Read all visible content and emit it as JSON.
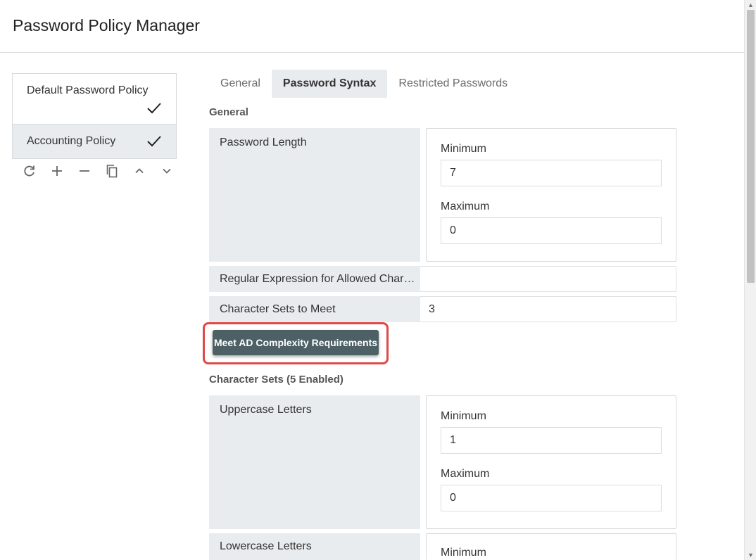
{
  "app": {
    "title": "Password Policy Manager"
  },
  "policies": [
    {
      "name": "Default Password Policy",
      "icon": "checkmark-icon",
      "selected": false
    },
    {
      "name": "Accounting Policy",
      "icon": "checkmark-icon",
      "selected": true
    }
  ],
  "toolbar": {
    "icons": [
      "refresh-icon",
      "plus-icon",
      "minus-icon",
      "copy-icon",
      "chevron-up-icon",
      "chevron-down-icon"
    ]
  },
  "tabs": [
    {
      "label": "General",
      "active": false
    },
    {
      "label": "Password Syntax",
      "active": true
    },
    {
      "label": "Restricted Passwords",
      "active": false
    }
  ],
  "general": {
    "title": "General",
    "password_length": {
      "label": "Password Length",
      "minimum_label": "Minimum",
      "minimum_value": "7",
      "maximum_label": "Maximum",
      "maximum_value": "0"
    },
    "regex": {
      "label": "Regular Expression for Allowed Char…",
      "value": ""
    },
    "char_sets_to_meet": {
      "label": "Character Sets to Meet",
      "value": "3"
    },
    "ad_button": "Meet AD Complexity Requirements"
  },
  "character_sets": {
    "title": "Character Sets (5 Enabled)",
    "uppercase": {
      "label": "Uppercase Letters",
      "minimum_label": "Minimum",
      "minimum_value": "1",
      "maximum_label": "Maximum",
      "maximum_value": "0"
    },
    "lowercase": {
      "label": "Lowercase Letters",
      "minimum_label": "Minimum"
    }
  },
  "colors": {
    "accent_button": "#4d6066",
    "highlight": "#e04848",
    "label_bg": "#e9ecef"
  }
}
